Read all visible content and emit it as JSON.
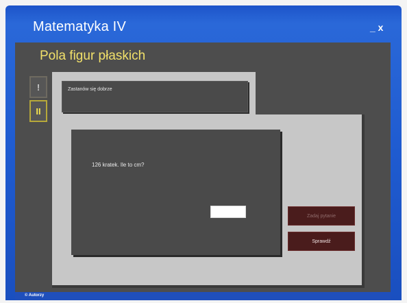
{
  "window": {
    "title": "Matematyka IV",
    "controls": "_ x"
  },
  "section": {
    "title": "Pola figur płaskich"
  },
  "sidebar": {
    "buttons": [
      {
        "label": "!"
      },
      {
        "label": "II"
      }
    ]
  },
  "task": {
    "instruction": "Zastanów się dobrze"
  },
  "question": {
    "text": "126 kratek. Ile to cm?",
    "answer_value": ""
  },
  "actions": {
    "hint_label": "Zadaj pytanie",
    "check_label": "Sprawdź"
  },
  "status": {
    "label": "© Autorzy"
  },
  "colors": {
    "window_blue": "#1f5bd0",
    "panel_dark": "#4d4d4d",
    "content_light": "#c7c7c7",
    "title_yellow": "#f1e06a",
    "button_maroon": "#4a1c1c"
  }
}
